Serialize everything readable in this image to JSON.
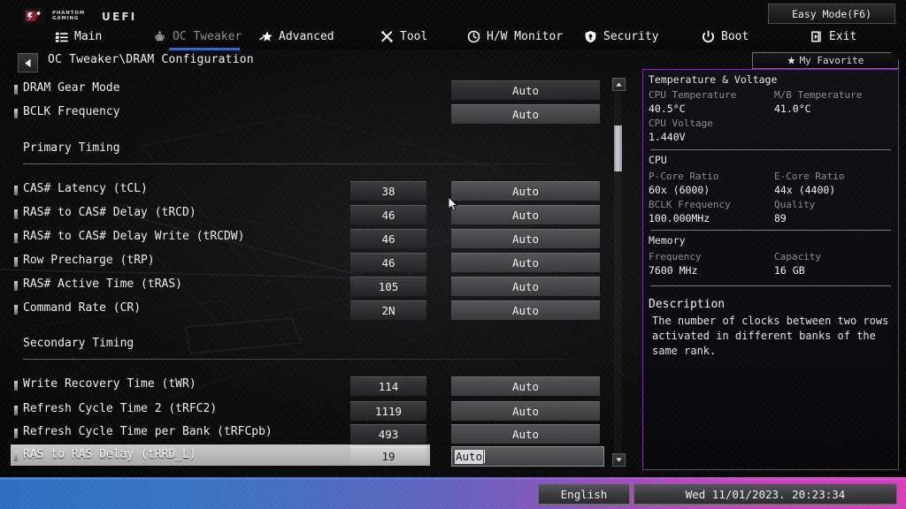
{
  "header": {
    "brand_line1": "PHANTOM",
    "brand_line2": "GAMING",
    "uefi": "UEFI",
    "easy_mode_label": "Easy Mode(F6)",
    "nav": [
      {
        "label": "Main",
        "icon": "list-icon",
        "active": false
      },
      {
        "label": "OC Tweaker",
        "icon": "tuner-icon",
        "active": true
      },
      {
        "label": "Advanced",
        "icon": "star-arrow-icon",
        "active": false
      },
      {
        "label": "Tool",
        "icon": "wrench-screwdriver-icon",
        "active": false
      },
      {
        "label": "H/W Monitor",
        "icon": "gauge-icon",
        "active": false
      },
      {
        "label": "Security",
        "icon": "shield-icon",
        "active": false
      },
      {
        "label": "Boot",
        "icon": "power-icon",
        "active": false
      },
      {
        "label": "Exit",
        "icon": "exit-door-icon",
        "active": false
      }
    ]
  },
  "breadcrumb": {
    "path": "OC Tweaker\\DRAM Configuration",
    "back_icon": "back-arrow-icon",
    "favorite_label": "My Favorite",
    "favorite_icon": "star-icon"
  },
  "list": {
    "top_items": [
      {
        "label": "DRAM Gear Mode",
        "value": "Auto",
        "style": "dark"
      },
      {
        "label": "BCLK Frequency",
        "value": "Auto",
        "style": "light"
      }
    ],
    "primary_section": "Primary Timing",
    "primary_items": [
      {
        "label": "CAS# Latency (tCL)",
        "number": "38",
        "value": "Auto"
      },
      {
        "label": "RAS# to CAS# Delay (tRCD)",
        "number": "46",
        "value": "Auto"
      },
      {
        "label": "RAS# to CAS# Delay Write (tRCDW)",
        "number": "46",
        "value": "Auto"
      },
      {
        "label": "Row Precharge (tRP)",
        "number": "46",
        "value": "Auto"
      },
      {
        "label": "RAS# Active Time (tRAS)",
        "number": "105",
        "value": "Auto"
      },
      {
        "label": "Command Rate (CR)",
        "number": "2N",
        "value": "Auto"
      }
    ],
    "secondary_section": "Secondary Timing",
    "secondary_items": [
      {
        "label": "Write Recovery Time (tWR)",
        "number": "114",
        "value": "Auto",
        "selected": false
      },
      {
        "label": "Refresh Cycle Time 2 (tRFC2)",
        "number": "1119",
        "value": "Auto",
        "selected": false
      },
      {
        "label": "Refresh Cycle Time per Bank (tRFCpb)",
        "number": "493",
        "value": "Auto",
        "selected": false
      },
      {
        "label": "RAS to RAS Delay (tRRD_L)",
        "number": "19",
        "value": "Auto",
        "selected": true
      }
    ]
  },
  "info": {
    "temp_voltage_title": "Temperature & Voltage",
    "cpu_temp_key": "CPU Temperature",
    "cpu_temp_val": "40.5°C",
    "mb_temp_key": "M/B Temperature",
    "mb_temp_val": "41.0°C",
    "cpu_voltage_key": "CPU Voltage",
    "cpu_voltage_val": "1.440V",
    "cpu_title": "CPU",
    "pcore_key": "P-Core Ratio",
    "pcore_val": "60x (6000)",
    "ecore_key": "E-Core Ratio",
    "ecore_val": "44x (4400)",
    "bclk_key": "BCLK Frequency",
    "bclk_val": "100.000MHz",
    "quality_key": "Quality",
    "quality_val": "89",
    "memory_title": "Memory",
    "mem_freq_key": "Frequency",
    "mem_freq_val": "7600 MHz",
    "mem_cap_key": "Capacity",
    "mem_cap_val": "16 GB",
    "description_title": "Description",
    "description_body": "The number of clocks between two rows activated in different banks of the same rank."
  },
  "bottom": {
    "language": "English",
    "clock": "Wed 11/01/2023. 20:23:34"
  },
  "colors": {
    "accent_blue": "#3b64c8",
    "panel_border": "#7a2fa0",
    "bar_left": "#2f6fc0",
    "bar_right": "#d93fb7",
    "highlight": "#c9c9c9"
  }
}
